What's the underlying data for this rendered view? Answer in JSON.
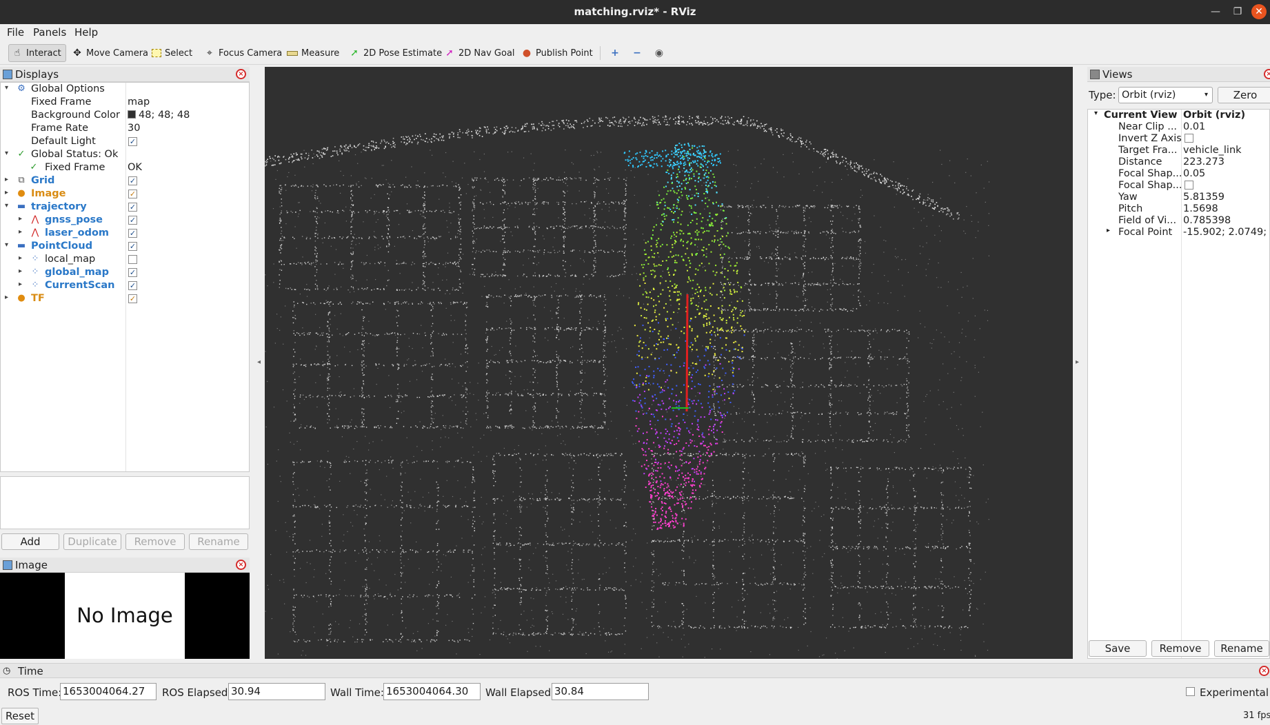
{
  "window": {
    "title": "matching.rviz* - RViz"
  },
  "menu": {
    "file": "File",
    "panels": "Panels",
    "help": "Help"
  },
  "toolbar": {
    "interact": "Interact",
    "move_camera": "Move Camera",
    "select": "Select",
    "focus_camera": "Focus Camera",
    "measure": "Measure",
    "pose_estimate": "2D Pose Estimate",
    "nav_goal": "2D Nav Goal",
    "publish_point": "Publish Point"
  },
  "displays": {
    "title": "Displays",
    "global_options": {
      "label": "Global Options",
      "fixed_frame_label": "Fixed Frame",
      "fixed_frame": "map",
      "bg_color_label": "Background Color",
      "bg_color": "48; 48; 48",
      "frame_rate_label": "Frame Rate",
      "frame_rate": "30",
      "default_light_label": "Default Light"
    },
    "global_status": {
      "label": "Global Status: Ok",
      "fixed_frame_label": "Fixed Frame",
      "fixed_frame": "OK"
    },
    "items": {
      "grid": "Grid",
      "image": "Image",
      "trajectory": "trajectory",
      "gnss_pose": "gnss_pose",
      "laser_odom": "laser_odom",
      "pointcloud": "PointCloud",
      "local_map": "local_map",
      "global_map": "global_map",
      "current_scan": "CurrentScan",
      "tf": "TF"
    },
    "buttons": {
      "add": "Add",
      "duplicate": "Duplicate",
      "remove": "Remove",
      "rename": "Rename"
    }
  },
  "image_panel": {
    "title": "Image",
    "placeholder": "No Image"
  },
  "views": {
    "title": "Views",
    "type_label": "Type:",
    "type_value": "Orbit (rviz)",
    "zero": "Zero",
    "current_view_label": "Current View",
    "current_view_value": "Orbit (rviz)",
    "props": {
      "near_clip": {
        "label": "Near Clip ...",
        "value": "0.01"
      },
      "invert_z": {
        "label": "Invert Z Axis"
      },
      "target_frame": {
        "label": "Target Fra...",
        "value": "vehicle_link"
      },
      "distance": {
        "label": "Distance",
        "value": "223.273"
      },
      "focal_shape_size": {
        "label": "Focal Shap...",
        "value": "0.05"
      },
      "focal_shape_fixed": {
        "label": "Focal Shap..."
      },
      "yaw": {
        "label": "Yaw",
        "value": "5.81359"
      },
      "pitch": {
        "label": "Pitch",
        "value": "1.5698"
      },
      "fov": {
        "label": "Field of Vi...",
        "value": "0.785398"
      },
      "focal_point": {
        "label": "Focal Point",
        "value": "-15.902; 2.0749; ..."
      }
    },
    "buttons": {
      "save": "Save",
      "remove": "Remove",
      "rename": "Rename"
    }
  },
  "time": {
    "title": "Time",
    "ros_time_label": "ROS Time:",
    "ros_time": "1653004064.27",
    "ros_elapsed_label": "ROS Elapsed:",
    "ros_elapsed": "30.94",
    "wall_time_label": "Wall Time:",
    "wall_time": "1653004064.30",
    "wall_elapsed_label": "Wall Elapsed:",
    "wall_elapsed": "30.84",
    "experimental": "Experimental",
    "reset": "Reset",
    "fps": "31 fps"
  },
  "colors": {
    "background": "#303030",
    "display_blue": "#2a78c8",
    "warning_orange": "#d98c14",
    "close_red": "#d42a2a"
  }
}
